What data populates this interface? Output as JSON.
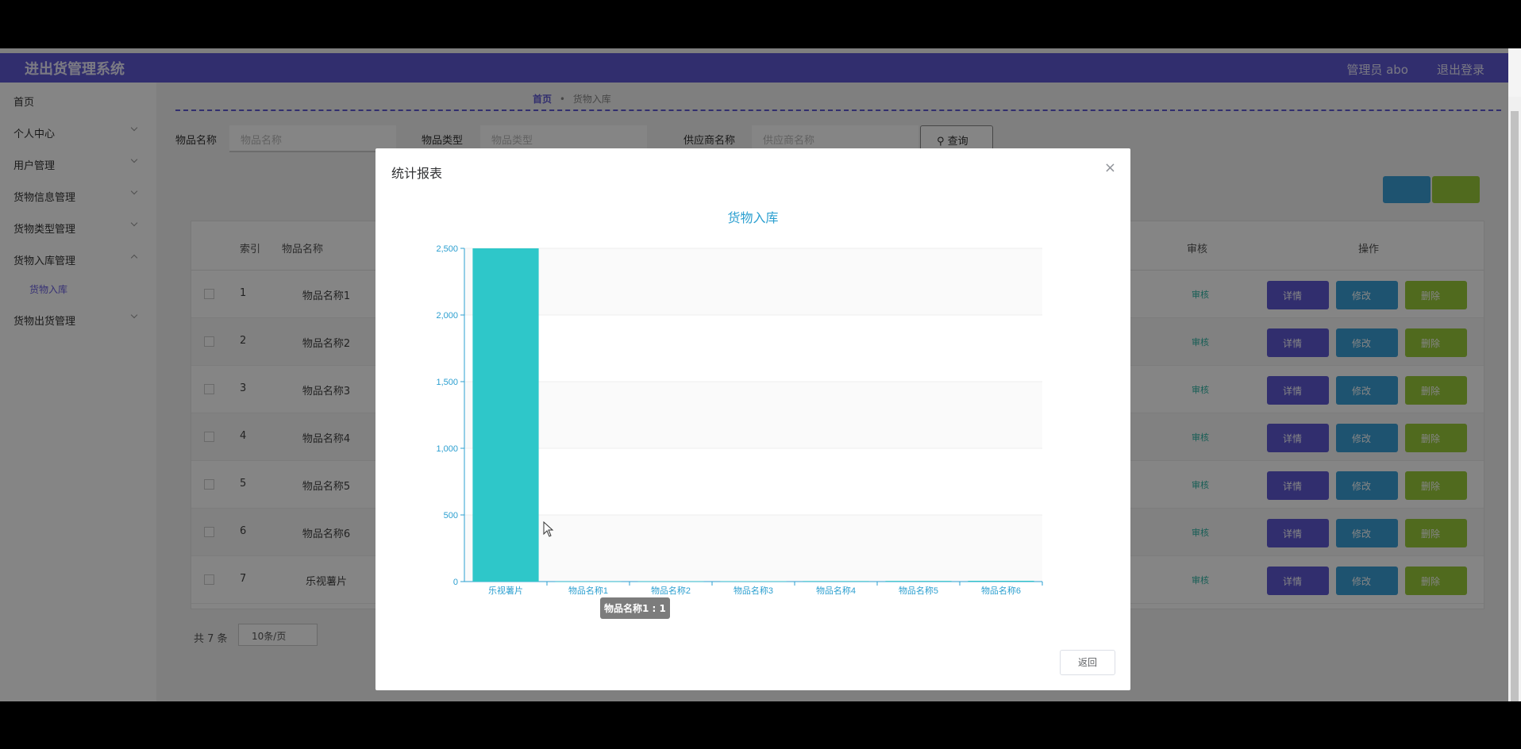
{
  "header": {
    "title": "进出货管理系统",
    "user": "管理员 abo",
    "logout": "退出登录"
  },
  "sidebar": {
    "items": [
      {
        "label": "首页"
      },
      {
        "label": "个人中心"
      },
      {
        "label": "用户管理"
      },
      {
        "label": "货物信息管理"
      },
      {
        "label": "货物类型管理"
      },
      {
        "label": "货物入库管理"
      },
      {
        "label": "货物出货管理"
      }
    ],
    "sub": "货物入库"
  },
  "breadcrumb": {
    "home": "首页",
    "current": "货物入库"
  },
  "search": {
    "name_label": "物品名称",
    "name_placeholder": "物品名称",
    "type_label": "物品类型",
    "type_placeholder": "物品类型",
    "supplier_label": "供应商名称",
    "supplier_placeholder": "供应商名称",
    "query": "查询"
  },
  "table": {
    "headers": {
      "index": "索引",
      "name": "物品名称",
      "audit": "审核",
      "op": "操作"
    },
    "rows": [
      {
        "idx": "1",
        "name": "物品名称1"
      },
      {
        "idx": "2",
        "name": "物品名称2"
      },
      {
        "idx": "3",
        "name": "物品名称3"
      },
      {
        "idx": "4",
        "name": "物品名称4"
      },
      {
        "idx": "5",
        "name": "物品名称5"
      },
      {
        "idx": "6",
        "name": "物品名称6"
      },
      {
        "idx": "7",
        "name": "乐视薯片"
      }
    ],
    "audit_label": "审核",
    "detail_label": "详情",
    "edit_label": "修改",
    "delete_label": "删除"
  },
  "pager": {
    "total": "共 7 条",
    "size": "10条/页"
  },
  "dialog": {
    "title": "统计报表",
    "close": "×",
    "return_label": "返回",
    "tooltip": "物品名称1 : 1"
  },
  "chart_data": {
    "type": "bar",
    "title": "货物入库",
    "categories": [
      "乐视薯片",
      "物品名称1",
      "物品名称2",
      "物品名称3",
      "物品名称4",
      "物品名称5",
      "物品名称6"
    ],
    "values": [
      2500,
      1,
      2,
      3,
      4,
      5,
      6
    ],
    "ylim": [
      0,
      2500
    ],
    "yticks": [
      "0",
      "500",
      "1,000",
      "1,500",
      "2,000",
      "2,500"
    ],
    "grid": true,
    "color": "#2ec7c9"
  },
  "colors": {
    "primary": "#5e58d4",
    "edit": "#3aa0d6",
    "delete": "#9acc3a",
    "bar": "#2ec7c9"
  }
}
